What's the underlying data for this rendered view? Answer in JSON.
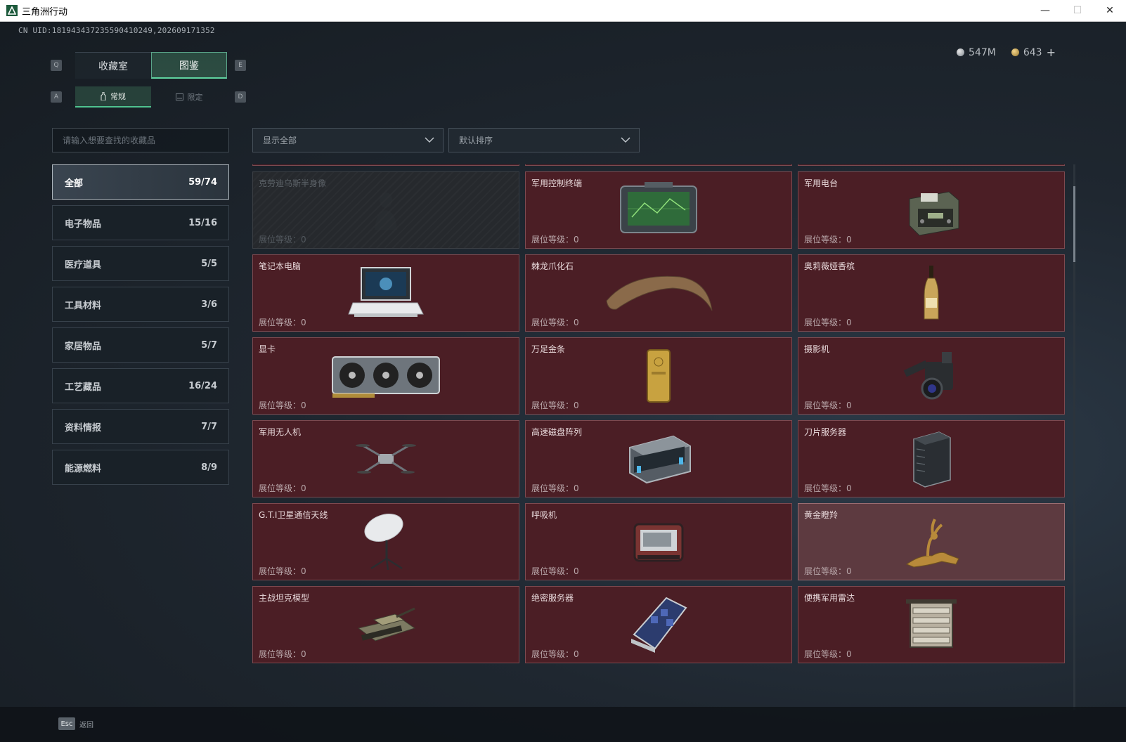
{
  "window": {
    "title": "三角洲行动",
    "minimize": "—",
    "maximize": "☐",
    "close": "✕"
  },
  "uid": "CN UID:1819434372355904102​49,202609171352",
  "currency": {
    "silver": "547M",
    "gold": "643",
    "add": "+"
  },
  "tabs_main": {
    "left_key": "Q",
    "right_key": "E",
    "items": [
      {
        "label": "收藏室",
        "active": false
      },
      {
        "label": "图鉴",
        "active": true
      }
    ]
  },
  "tabs_sub": {
    "left_key": "A",
    "right_key": "D",
    "items": [
      {
        "label": "常规",
        "icon": "bottle-icon",
        "active": true
      },
      {
        "label": "限定",
        "icon": "frame-icon",
        "active": false
      }
    ]
  },
  "search": {
    "placeholder": "请输入想要查找的收藏品"
  },
  "filters": {
    "show": "显示全部",
    "sort": "默认排序"
  },
  "categories": [
    {
      "label": "全部",
      "count": "59/74",
      "active": true
    },
    {
      "label": "电子物品",
      "count": "15/16"
    },
    {
      "label": "医疗道具",
      "count": "5/5"
    },
    {
      "label": "工具材料",
      "count": "3/6"
    },
    {
      "label": "家居物品",
      "count": "5/7"
    },
    {
      "label": "工艺藏品",
      "count": "16/24"
    },
    {
      "label": "资料情报",
      "count": "7/7"
    },
    {
      "label": "能源燃料",
      "count": "8/9"
    }
  ],
  "level_label": "展位等级：0",
  "items": [
    {
      "name": "",
      "icon": "blank",
      "state": "normal"
    },
    {
      "name": "",
      "icon": "blank",
      "state": "normal"
    },
    {
      "name": "",
      "icon": "blank",
      "state": "normal"
    },
    {
      "name": "克劳迪乌斯半身像",
      "icon": "bust-icon",
      "state": "dim"
    },
    {
      "name": "军用控制终端",
      "icon": "control-terminal-icon",
      "state": "normal"
    },
    {
      "name": "军用电台",
      "icon": "military-radio-icon",
      "state": "normal"
    },
    {
      "name": "笔记本电脑",
      "icon": "laptop-icon",
      "state": "normal"
    },
    {
      "name": "棘龙爪化石",
      "icon": "claw-fossil-icon",
      "state": "normal"
    },
    {
      "name": "奥莉薇娅香槟",
      "icon": "champagne-icon",
      "state": "normal"
    },
    {
      "name": "显卡",
      "icon": "gpu-icon",
      "state": "normal"
    },
    {
      "name": "万足金条",
      "icon": "gold-bar-icon",
      "state": "normal"
    },
    {
      "name": "摄影机",
      "icon": "camera-icon",
      "state": "normal"
    },
    {
      "name": "军用无人机",
      "icon": "drone-icon",
      "state": "normal"
    },
    {
      "name": "高速磁盘阵列",
      "icon": "disk-array-icon",
      "state": "normal"
    },
    {
      "name": "刀片服务器",
      "icon": "blade-server-icon",
      "state": "normal"
    },
    {
      "name": "G.T.I卫星通信天线",
      "icon": "satellite-dish-icon",
      "state": "normal"
    },
    {
      "name": "呼吸机",
      "icon": "ventilator-icon",
      "state": "normal"
    },
    {
      "name": "黄金瞪羚",
      "icon": "golden-gazelle-icon",
      "state": "highlight"
    },
    {
      "name": "主战坦克模型",
      "icon": "tank-model-icon",
      "state": "normal"
    },
    {
      "name": "绝密服务器",
      "icon": "secret-server-icon",
      "state": "normal"
    },
    {
      "name": "便携军用雷达",
      "icon": "portable-radar-icon",
      "state": "normal"
    }
  ],
  "bottom": {
    "esc_key": "Esc",
    "back": "返回"
  }
}
